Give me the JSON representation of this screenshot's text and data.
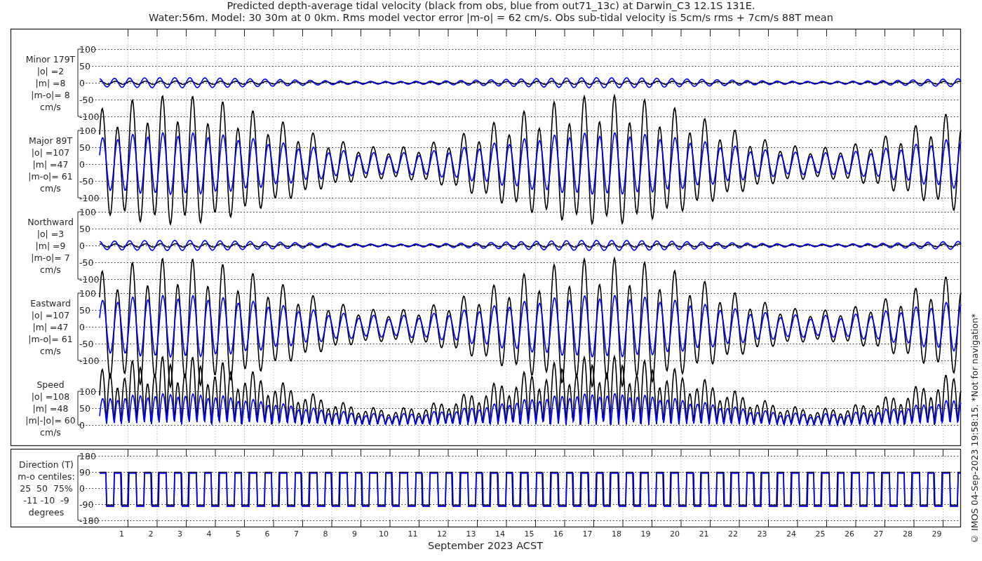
{
  "title": [
    "Predicted depth-average tidal velocity (black from obs, blue from out71_13c) at Darwin_C3 12.1S 131E.",
    "Water:56m. Model: 30 30m at 0 0km. Rms model vector error |m-o| = 62 cm/s. Obs sub-tidal velocity is 5cm/s rms + 7cm/s 88T mean"
  ],
  "panels": [
    {
      "kind": "minor",
      "label_lines": [
        "Minor 179T",
        "|o| =2",
        "|m| =8",
        "|m-o|= 8",
        "cm/s"
      ],
      "yticks": [
        "100",
        "50",
        "0",
        "-50",
        "-100"
      ]
    },
    {
      "kind": "major",
      "label_lines": [
        "Major 89T",
        "|o| =107",
        "|m| =47",
        "|m-o|= 61",
        "cm/s"
      ],
      "yticks": [
        "100",
        "50",
        "0",
        "-50",
        "-100"
      ]
    },
    {
      "kind": "minor",
      "label_lines": [
        "Northward",
        "|o| =3",
        "|m| =9",
        "|m-o|= 7",
        "cm/s"
      ],
      "yticks": [
        "100",
        "50",
        "0",
        "-50",
        "-100"
      ]
    },
    {
      "kind": "major",
      "label_lines": [
        "Eastward",
        "|o| =107",
        "|m| =47",
        "|m-o|= 61",
        "cm/s"
      ],
      "yticks": [
        "100",
        "50",
        "0",
        "-50",
        "-100"
      ]
    },
    {
      "kind": "speed",
      "label_lines": [
        "Speed",
        "|o| =108",
        "|m| =48",
        "|m|-|o|= 60",
        "cm/s"
      ],
      "yticks": [
        "100",
        "50",
        "0"
      ]
    }
  ],
  "direction_panel": {
    "kind": "direction",
    "label_lines": [
      "Direction (T)",
      "m-o centiles:",
      "25  50  75%",
      "-11 -10  -9",
      "degrees"
    ],
    "yticks": [
      "180",
      "90",
      "0",
      "-90",
      "-180"
    ]
  },
  "xticks": [
    "1",
    "2",
    "3",
    "4",
    "5",
    "6",
    "7",
    "8",
    "9",
    "10",
    "11",
    "12",
    "13",
    "14",
    "15",
    "16",
    "17",
    "18",
    "19",
    "20",
    "21",
    "22",
    "23",
    "24",
    "25",
    "26",
    "27",
    "28",
    "29"
  ],
  "xlabel": "September 2023 ACST",
  "credit": "© IMOS 04-Sep-2023 19:58:15. *Not for navigation*"
}
